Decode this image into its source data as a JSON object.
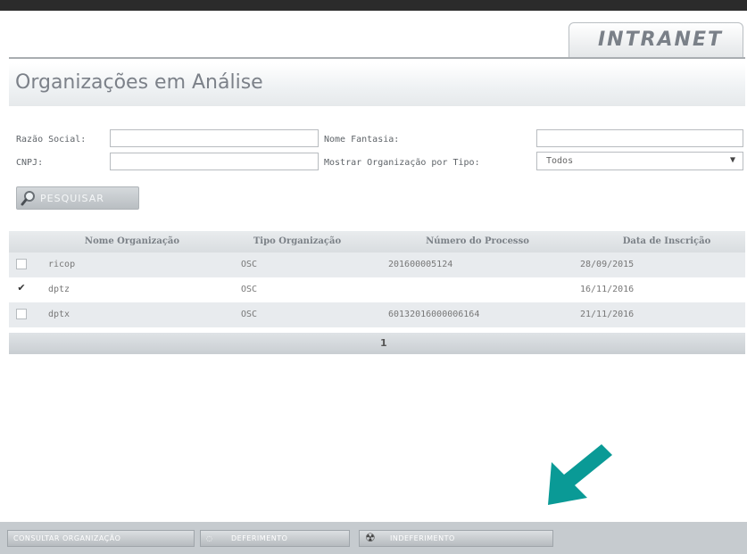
{
  "header": {
    "tab_label": "INTRANET"
  },
  "page": {
    "title": "Organizações em Análise"
  },
  "filters": {
    "razao_social_label": "Razão Social:",
    "razao_social_value": "",
    "nome_fantasia_label": "Nome Fantasia:",
    "nome_fantasia_value": "",
    "cnpj_label": "CNPJ:",
    "cnpj_value": "",
    "tipo_label": "Mostrar Organização por Tipo:",
    "tipo_selected": "Todos",
    "search_button": "PESQUISAR"
  },
  "table": {
    "columns": [
      "Nome Organização",
      "Tipo Organização",
      "Número do Processo",
      "Data de Inscrição"
    ],
    "rows": [
      {
        "checked": false,
        "nome": "ricop",
        "tipo": "OSC",
        "processo": "201600005124",
        "data": "28/09/2015"
      },
      {
        "checked": true,
        "nome": "dptz",
        "tipo": "OSC",
        "processo": "",
        "data": "16/11/2016"
      },
      {
        "checked": false,
        "nome": "dptx",
        "tipo": "OSC",
        "processo": "60132016000006164",
        "data": "21/11/2016"
      }
    ],
    "pager": "1"
  },
  "footer": {
    "btn1": "CONSULTAR ORGANIZAÇÃO",
    "btn2": "DEFERIMENTO",
    "btn3": "INDEFERIMENTO"
  },
  "colors": {
    "arrow": "#0a9a96",
    "top_bar": "#2b2b2b"
  },
  "icons": [
    "search-icon",
    "checkbox-icon",
    "arrow-down-left-icon"
  ]
}
